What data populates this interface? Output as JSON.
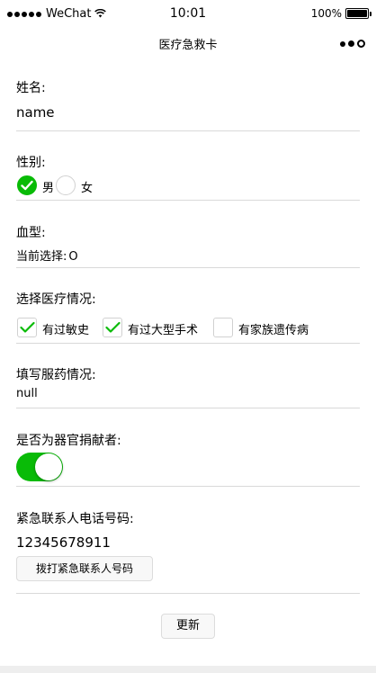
{
  "status_bar": {
    "carrier": "WeChat",
    "time": "10:01",
    "battery": "100%",
    "battery_level": 1.0
  },
  "nav": {
    "title": "医疗急救卡"
  },
  "name": {
    "label": "姓名:",
    "value": "name"
  },
  "gender": {
    "label": "性别:",
    "options": [
      "男",
      "女"
    ],
    "selected": "男"
  },
  "blood": {
    "label": "血型:",
    "current_prefix": "当前选择:",
    "current_value": "O"
  },
  "medical": {
    "label": "选择医疗情况:",
    "options": [
      {
        "label": "有过敏史",
        "checked": true
      },
      {
        "label": "有过大型手术",
        "checked": true
      },
      {
        "label": "有家族遗传病",
        "checked": false
      }
    ]
  },
  "medication": {
    "label": "填写服药情况:",
    "value": "null"
  },
  "donor": {
    "label": "是否为器官捐献者:",
    "on": true
  },
  "emergency": {
    "label": "紧急联系人电话号码:",
    "phone": "12345678911",
    "call_button": "拨打紧急联系人号码"
  },
  "update_button": "更新",
  "colors": {
    "accent": "#09bb07",
    "divider": "#d9d9d9"
  }
}
